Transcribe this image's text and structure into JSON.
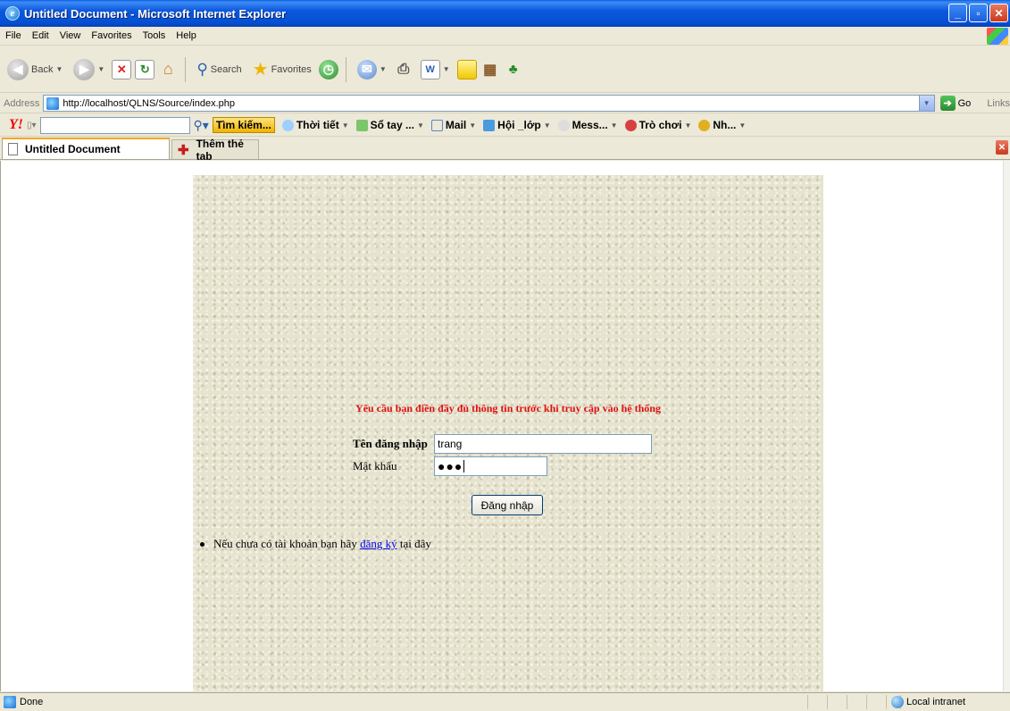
{
  "window": {
    "title": "Untitled Document - Microsoft Internet Explorer"
  },
  "menu": [
    "File",
    "Edit",
    "View",
    "Favorites",
    "Tools",
    "Help"
  ],
  "toolbar": {
    "back": "Back",
    "search": "Search",
    "favorites": "Favorites"
  },
  "address": {
    "label": "Address",
    "url": "http://localhost/QLNS/Source/index.php",
    "go": "Go",
    "links": "Links"
  },
  "yahoo": {
    "search_button": "Tìm kiếm...",
    "items": [
      "Thời tiết",
      "Sổ tay ...",
      "Mail",
      "Hội _lớp",
      "Mess...",
      "Trò chơi",
      "Nh..."
    ]
  },
  "tabs": {
    "active": "Untitled Document",
    "new_tab": "Thêm thẻ tab"
  },
  "page": {
    "notice": "Yêu cầu bạn điền đầy đủ thông tin trước khi truy cập vào hệ thống",
    "username_label": "Tên đăng nhập",
    "username_value": "trang",
    "password_label": "Mật khẩu",
    "password_mask": "●●●",
    "login_button": "Đăng nhập",
    "register_prefix": "Nếu chưa có tài khoản bạn hãy",
    "register_link": "đăng ký",
    "register_suffix": "tại đây"
  },
  "status": {
    "text": "Done",
    "zone": "Local intranet"
  }
}
